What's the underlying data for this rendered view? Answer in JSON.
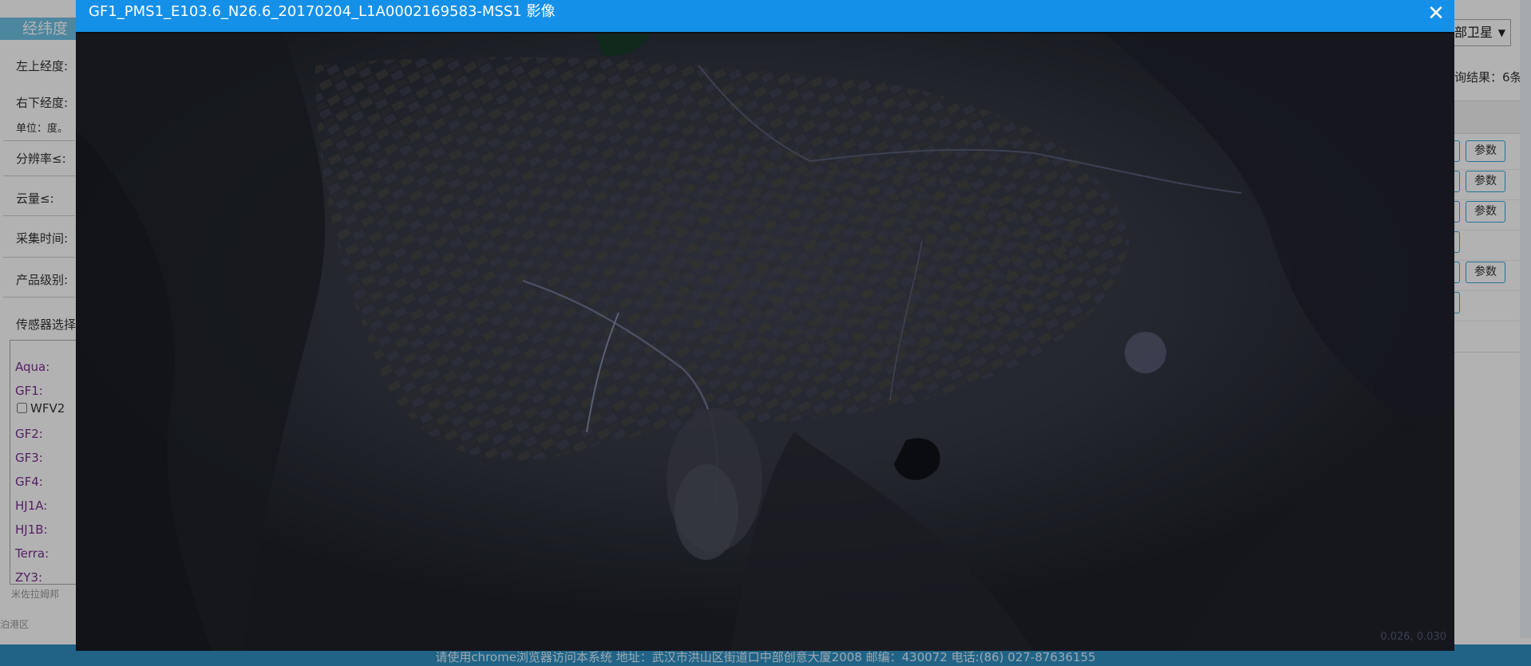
{
  "left_panel": {
    "title": "经纬度",
    "upper_left": "左上经度:",
    "lower_right": "右下经度:",
    "unit": "单位：度。",
    "resolution": "分辨率≤:",
    "cloud": "云量≤:",
    "acquire_time": "采集时间:",
    "product_level": "产品级别:",
    "sensor_select": "传感器选择",
    "sensors": [
      "Aqua:",
      "GF1:",
      "GF2:",
      "GF3:",
      "GF4:",
      "HJ1A:",
      "HJ1B:",
      "Terra:",
      "ZY3:"
    ],
    "gf1_option": "WFV2",
    "map_hints": [
      "米佐拉姆邦",
      "泊港区"
    ]
  },
  "right_panel": {
    "satellite_select": "部卫星",
    "result_count": "询结果：6条",
    "param_label": "参数",
    "rows": [
      {
        "has_param": true
      },
      {
        "has_param": true
      },
      {
        "has_param": true
      },
      {
        "has_param": false
      },
      {
        "has_param": true
      },
      {
        "has_param": false
      }
    ]
  },
  "modal": {
    "title": "GF1_PMS1_E103.6_N26.6_20170204_L1A0002169583-MSS1 影像",
    "close_icon": "close-icon",
    "coord_readout": "0.026, 0.030"
  },
  "footer": {
    "text": "请使用chrome浏览器访问本系统    地址：武汉市洪山区街道口中部创意大厦2008    邮编：430072    电话:(86) 027-87636155"
  },
  "colors": {
    "modal_header": "#1590e8",
    "panel_title": "#6fc0e4",
    "footer": "#2f8fc2",
    "imagery_dark": "#1d1f27"
  }
}
